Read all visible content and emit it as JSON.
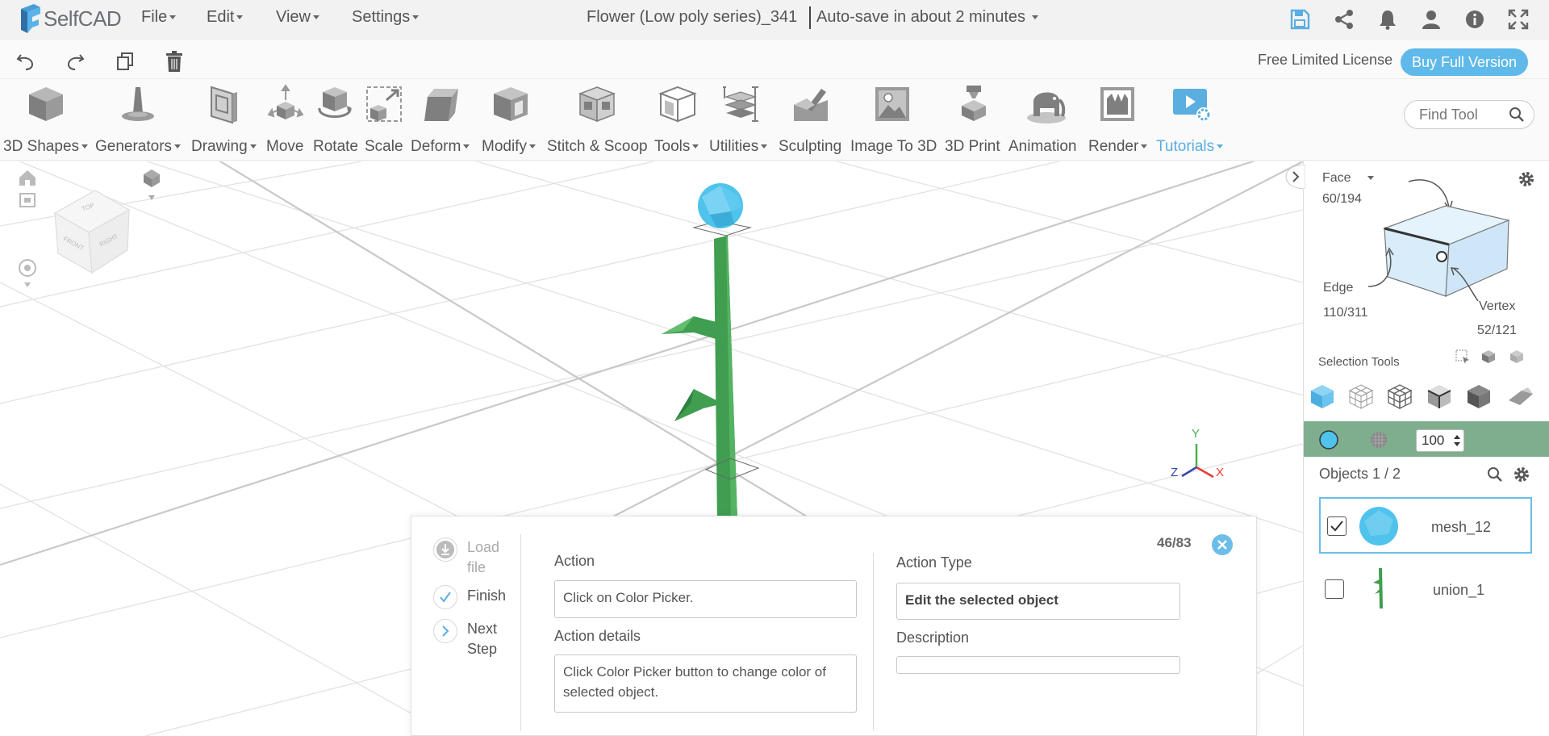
{
  "app": {
    "name": "SelfCAD"
  },
  "menus": [
    {
      "label": "File"
    },
    {
      "label": "Edit"
    },
    {
      "label": "View"
    },
    {
      "label": "Settings"
    }
  ],
  "document": {
    "title": "Flower (Low poly series)_341",
    "autosave": "Auto-save in about 2 minutes"
  },
  "license": {
    "text": "Free Limited License",
    "buy_label": "Buy Full Version"
  },
  "tools": [
    {
      "label": "3D Shapes",
      "dropdown": true
    },
    {
      "label": "Generators",
      "dropdown": true
    },
    {
      "label": "Drawing",
      "dropdown": true
    },
    {
      "label": "Move",
      "dropdown": false
    },
    {
      "label": "Rotate",
      "dropdown": false
    },
    {
      "label": "Scale",
      "dropdown": false
    },
    {
      "label": "Deform",
      "dropdown": true
    },
    {
      "label": "Modify",
      "dropdown": true
    },
    {
      "label": "Stitch & Scoop",
      "dropdown": false
    },
    {
      "label": "Tools",
      "dropdown": true
    },
    {
      "label": "Utilities",
      "dropdown": true
    },
    {
      "label": "Sculpting",
      "dropdown": false
    },
    {
      "label": "Image To 3D",
      "dropdown": false
    },
    {
      "label": "3D Print",
      "dropdown": false
    },
    {
      "label": "Animation",
      "dropdown": false
    },
    {
      "label": "Render",
      "dropdown": true
    },
    {
      "label": "Tutorials",
      "dropdown": true
    }
  ],
  "find_tool": {
    "placeholder": "Find Tool"
  },
  "viewcube": {
    "front": "FRONT",
    "right": "RIGHT",
    "top": "TOP"
  },
  "axes": {
    "x": "X",
    "y": "Y",
    "z": "Z"
  },
  "selection": {
    "mode": "Face",
    "face_count": "60/194",
    "edge_label": "Edge",
    "edge_count": "110/311",
    "vertex_label": "Vertex",
    "vertex_count": "52/121",
    "tools_label": "Selection Tools"
  },
  "material": {
    "opacity": "100",
    "color": "#4fc3ec"
  },
  "objects": {
    "header": "Objects 1 / 2",
    "items": [
      {
        "name": "mesh_12",
        "checked": true
      },
      {
        "name": "union_1",
        "checked": false
      }
    ]
  },
  "tutorial": {
    "counter": "46/83",
    "steps": [
      {
        "label": "Load file"
      },
      {
        "label": "Finish"
      },
      {
        "label": "Next Step"
      }
    ],
    "action_label": "Action",
    "action_value": "Click on Color Picker.",
    "details_label": "Action details",
    "details_value": "Click Color Picker button to change color of selected object.",
    "type_label": "Action Type",
    "type_value": "Edit the selected object",
    "description_label": "Description",
    "description_value": ""
  },
  "colors": {
    "accent": "#5fb9ea",
    "stem": "#3f9e4f",
    "sphere": "#4fc3ec",
    "strip": "#7fae8f"
  }
}
